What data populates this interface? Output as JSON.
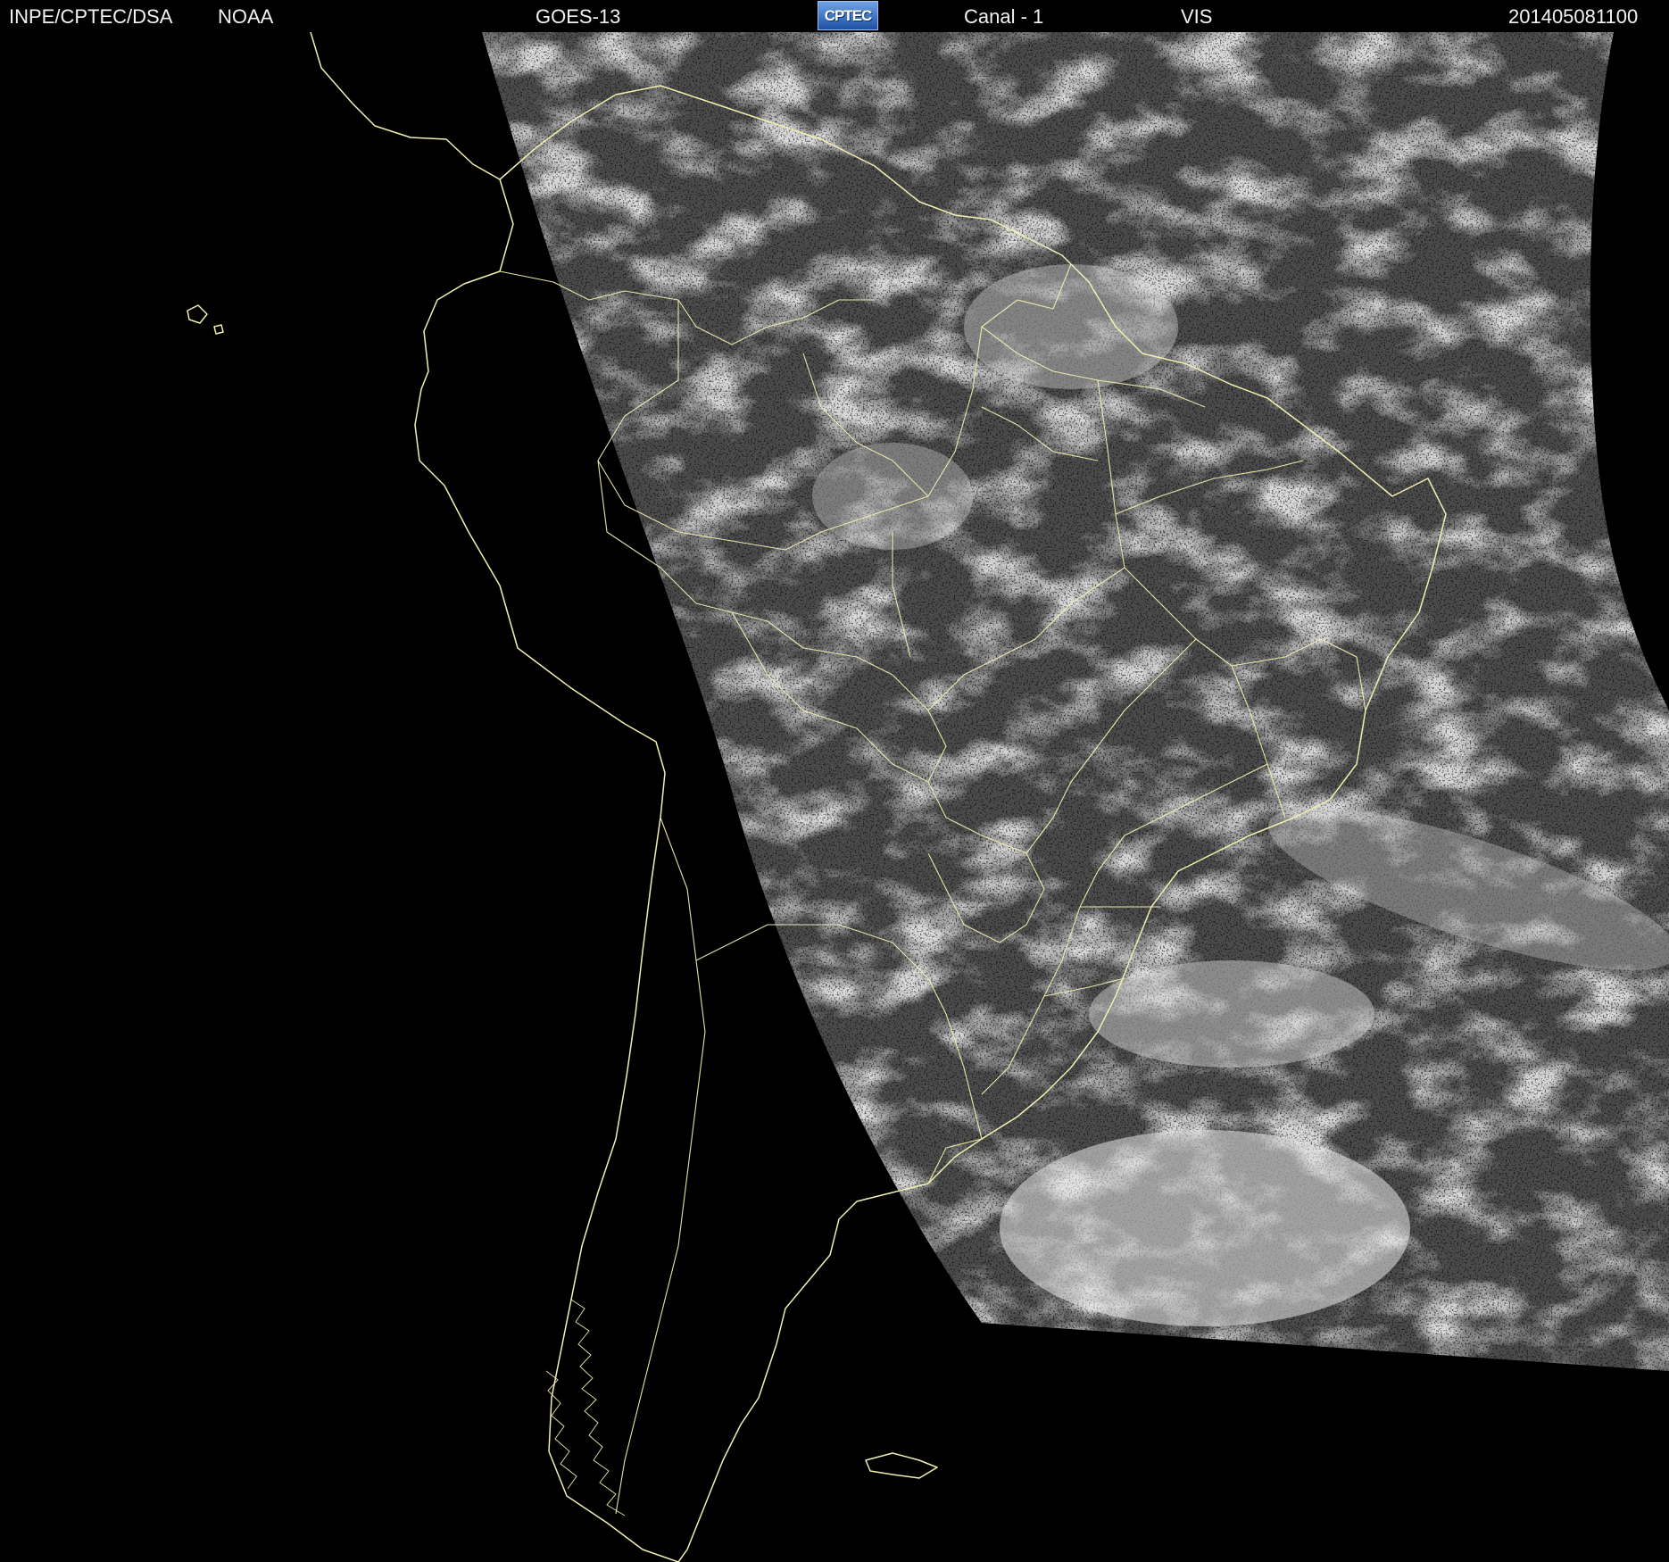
{
  "header": {
    "agency": "INPE/CPTEC/DSA",
    "provider": "NOAA",
    "satellite": "GOES-13",
    "logo_text": "CPTEC",
    "channel": "Canal - 1",
    "band": "VIS",
    "timestamp": "201405081100"
  },
  "map": {
    "background_color": "#000000",
    "border_color": "#f2f0b0",
    "cloud_color": "#ffffff",
    "imagery_base_color": "#3c3c3c"
  }
}
